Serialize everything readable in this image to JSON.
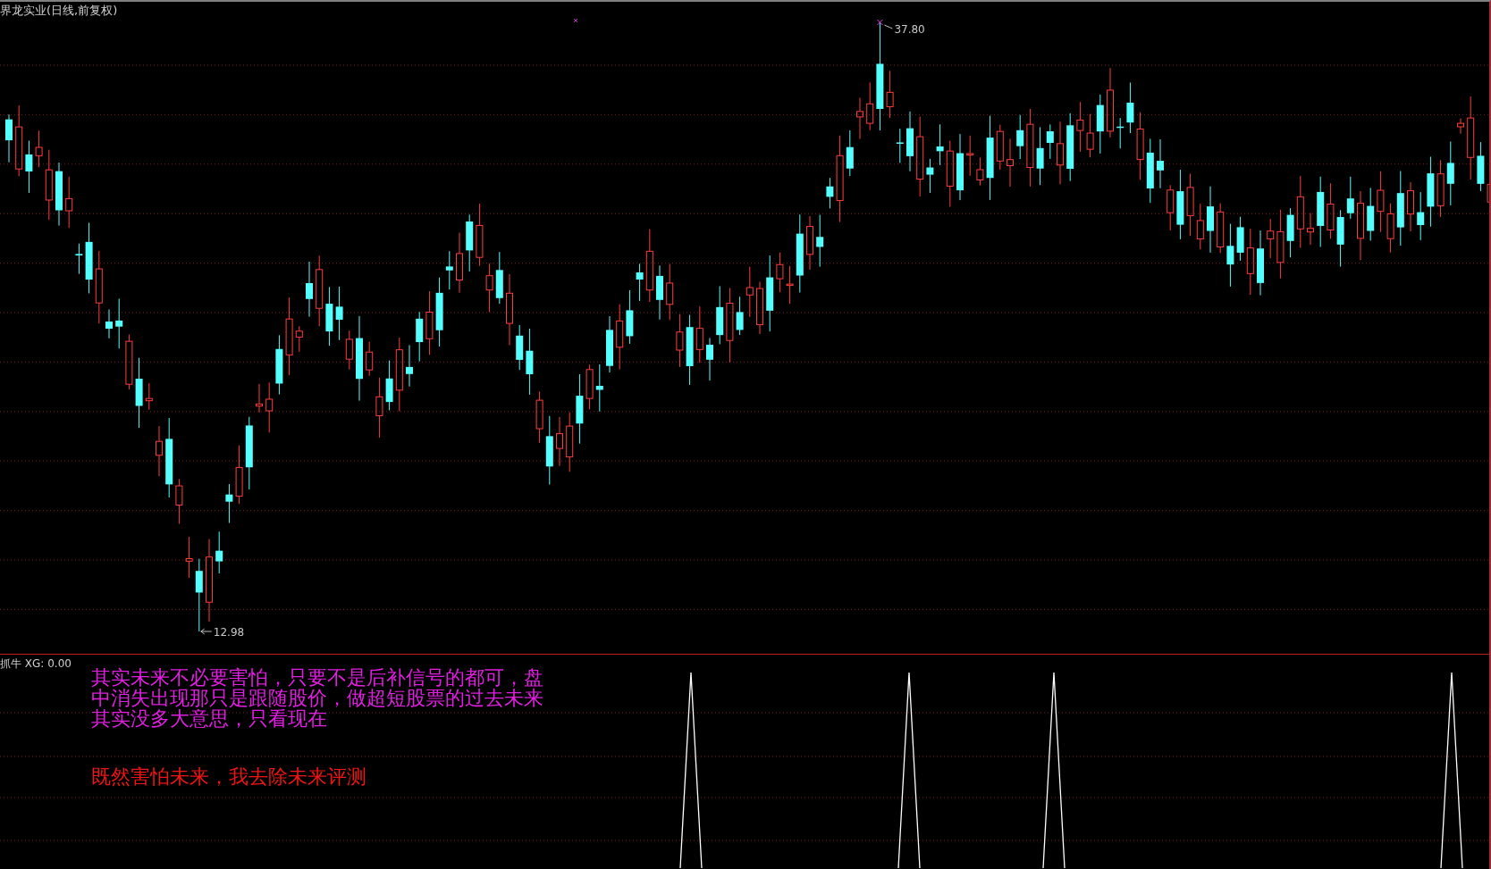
{
  "window": {
    "title": "界龙实业(日线,前复权)"
  },
  "price_chart": {
    "high_label": "37.80",
    "low_label": "12.98"
  },
  "indicator": {
    "label": "抓牛 XG: 0.00",
    "notes": [
      {
        "text": "其实未来不必要害怕，只要不是后补信号的都可，盘中消失出现那只是跟随股价，做超短股票的过去未来其实没多大意思，只看现在",
        "color": "#e21ee2"
      },
      {
        "text": "既然害怕未来，我去除未来评测",
        "color": "#f01414"
      }
    ]
  }
}
